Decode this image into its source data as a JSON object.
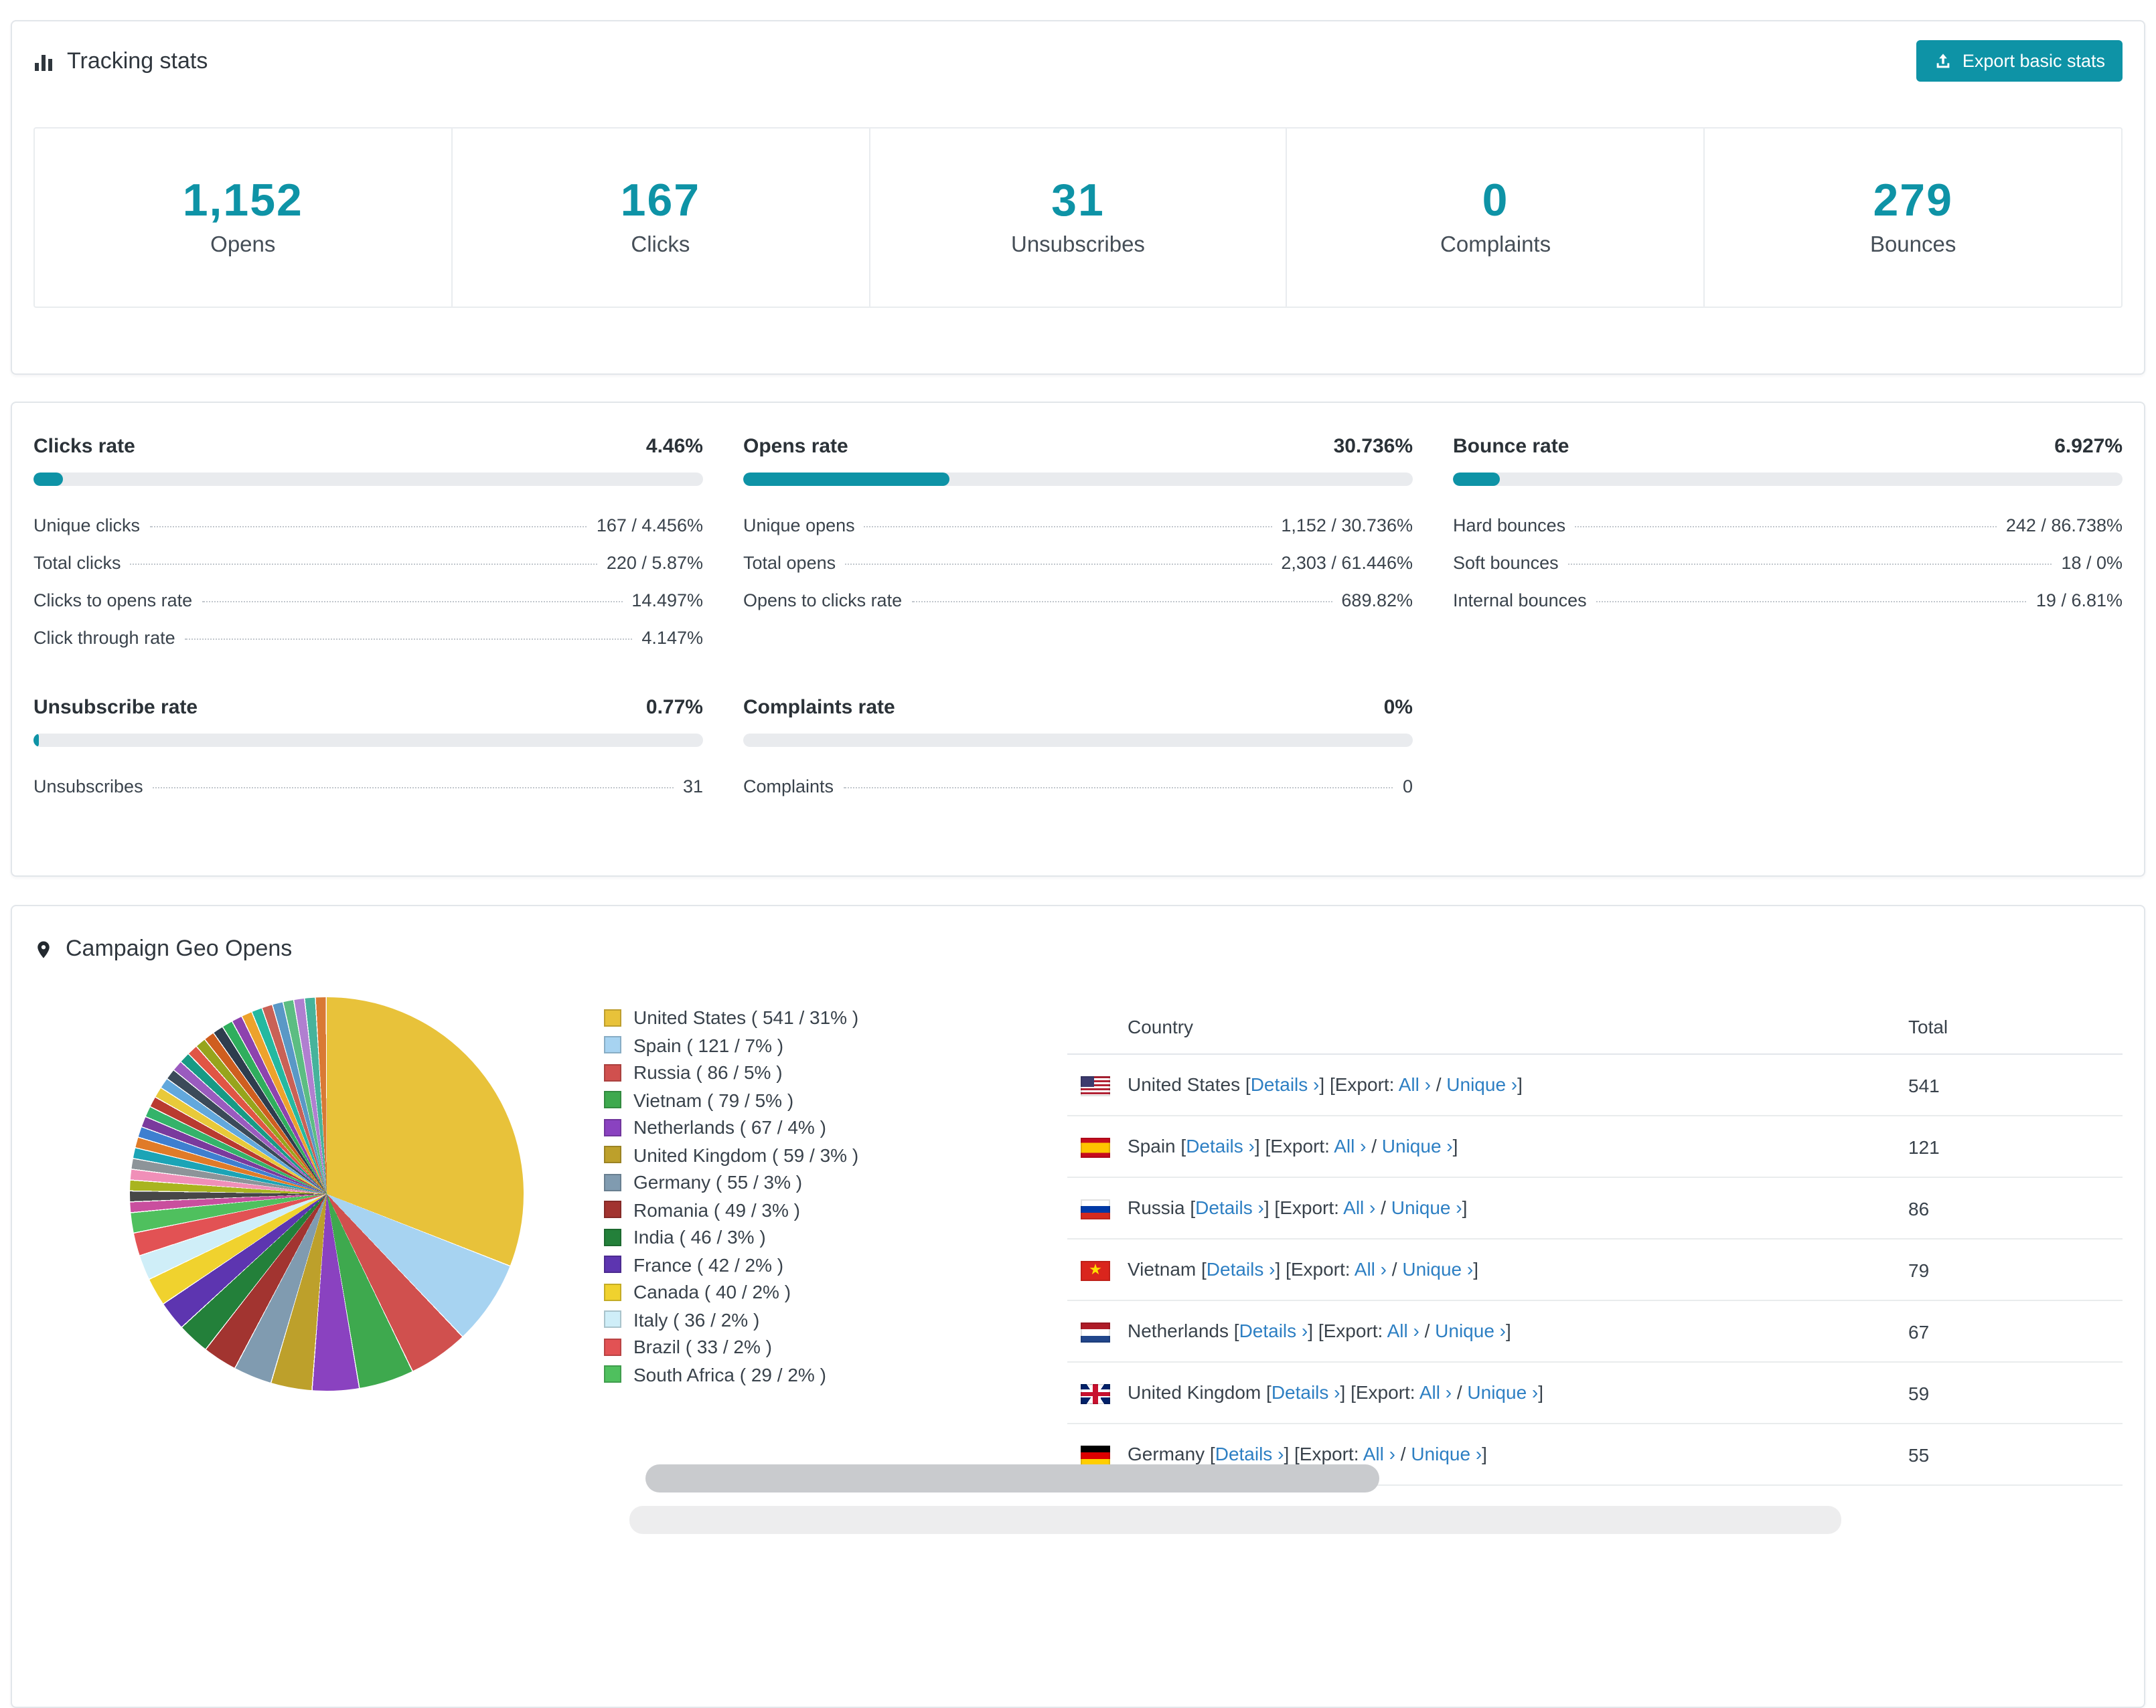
{
  "colors": {
    "accent": "#0e93a6",
    "link": "#2d7fc3"
  },
  "tracking": {
    "title": "Tracking stats",
    "export_button": "Export basic stats",
    "stats": [
      {
        "value": "1,152",
        "label": "Opens"
      },
      {
        "value": "167",
        "label": "Clicks"
      },
      {
        "value": "31",
        "label": "Unsubscribes"
      },
      {
        "value": "0",
        "label": "Complaints"
      },
      {
        "value": "279",
        "label": "Bounces"
      }
    ]
  },
  "rates": [
    {
      "title": "Clicks rate",
      "value": "4.46%",
      "bar_percent": 4.46,
      "rows": [
        {
          "label": "Unique clicks",
          "value": "167 / 4.456%"
        },
        {
          "label": "Total clicks",
          "value": "220 / 5.87%"
        },
        {
          "label": "Clicks to opens rate",
          "value": "14.497%"
        },
        {
          "label": "Click through rate",
          "value": "4.147%"
        }
      ]
    },
    {
      "title": "Opens rate",
      "value": "30.736%",
      "bar_percent": 30.736,
      "rows": [
        {
          "label": "Unique opens",
          "value": "1,152 / 30.736%"
        },
        {
          "label": "Total opens",
          "value": "2,303 / 61.446%"
        },
        {
          "label": "Opens to clicks rate",
          "value": "689.82%"
        }
      ]
    },
    {
      "title": "Bounce rate",
      "value": "6.927%",
      "bar_percent": 6.927,
      "rows": [
        {
          "label": "Hard bounces",
          "value": "242 / 86.738%"
        },
        {
          "label": "Soft bounces",
          "value": "18 / 0%"
        },
        {
          "label": "Internal bounces",
          "value": "19 / 6.81%"
        }
      ]
    },
    {
      "title": "Unsubscribe rate",
      "value": "0.77%",
      "bar_percent": 0.77,
      "rows": [
        {
          "label": "Unsubscribes",
          "value": "31"
        }
      ]
    },
    {
      "title": "Complaints rate",
      "value": "0%",
      "bar_percent": 0,
      "rows": [
        {
          "label": "Complaints",
          "value": "0"
        }
      ]
    }
  ],
  "geo": {
    "title": "Campaign Geo Opens",
    "table": {
      "headers": [
        "Country",
        "Total"
      ],
      "chevron": "›",
      "labels": {
        "details": "Details",
        "export": "Export:",
        "all": "All",
        "unique": "Unique"
      },
      "rows": [
        {
          "country": "United States",
          "flag": "us",
          "total": "541"
        },
        {
          "country": "Spain",
          "flag": "es",
          "total": "121"
        },
        {
          "country": "Russia",
          "flag": "ru",
          "total": "86"
        },
        {
          "country": "Vietnam",
          "flag": "vn",
          "total": "79"
        },
        {
          "country": "Netherlands",
          "flag": "nl",
          "total": "67"
        },
        {
          "country": "United Kingdom",
          "flag": "gb",
          "total": "59"
        },
        {
          "country": "Germany",
          "flag": "de",
          "total": "55"
        }
      ]
    },
    "chart_data": {
      "type": "pie",
      "title": "Campaign Geo Opens",
      "legend_position": "right",
      "legend_format": "{name} ( {count} / {pct}% )",
      "slices": [
        {
          "name": "United States",
          "count": 541,
          "pct": 31,
          "color": "#e8c23a"
        },
        {
          "name": "Spain",
          "count": 121,
          "pct": 7,
          "color": "#a7d3f1"
        },
        {
          "name": "Russia",
          "count": 86,
          "pct": 5,
          "color": "#d0504e"
        },
        {
          "name": "Vietnam",
          "count": 79,
          "pct": 5,
          "color": "#3ea94e"
        },
        {
          "name": "Netherlands",
          "count": 67,
          "pct": 4,
          "color": "#8a42c0"
        },
        {
          "name": "United Kingdom",
          "count": 59,
          "pct": 3,
          "color": "#bda02b"
        },
        {
          "name": "Germany",
          "count": 55,
          "pct": 3,
          "color": "#809bb0"
        },
        {
          "name": "Romania",
          "count": 49,
          "pct": 3,
          "color": "#a23430"
        },
        {
          "name": "India",
          "count": 46,
          "pct": 3,
          "color": "#23803a"
        },
        {
          "name": "France",
          "count": 42,
          "pct": 2,
          "color": "#5d35b0"
        },
        {
          "name": "Canada",
          "count": 40,
          "pct": 2,
          "color": "#f0d22e"
        },
        {
          "name": "Italy",
          "count": 36,
          "pct": 2,
          "color": "#cfeef8"
        },
        {
          "name": "Brazil",
          "count": 33,
          "pct": 2,
          "color": "#e25254"
        },
        {
          "name": "South Africa",
          "count": 29,
          "pct": 2,
          "color": "#4fc05e"
        }
      ],
      "others": {
        "total_count": 462,
        "colors": [
          "#c94f9e",
          "#474747",
          "#a9b41f",
          "#f08fb8",
          "#8d9499",
          "#1ba4b6",
          "#e07b28",
          "#3e7fd0",
          "#7a3a9d",
          "#34b36a",
          "#b93a30",
          "#e8c93a",
          "#62a8dc",
          "#3b4a59",
          "#9a5bbf",
          "#189a85",
          "#e05545",
          "#97a41c",
          "#cf5e1f",
          "#2e3d4e",
          "#2fae5d",
          "#8d43ae",
          "#eda22c",
          "#25b9a0",
          "#c96156",
          "#5a98c6",
          "#5cbd82",
          "#b07fd0",
          "#46b39b",
          "#d97934"
        ]
      }
    }
  }
}
